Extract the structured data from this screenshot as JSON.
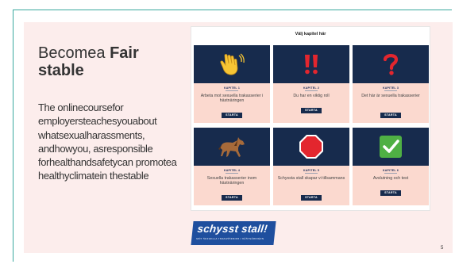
{
  "slide": {
    "title_plain": "Becomea",
    "title_bold_1": "Fair",
    "title_bold_2": "stable",
    "description": "The onlinecoursefor employersteachesyouabout whatsexualharassments, andhowyou, asresponsible forhealthandsafetycan promotea healthyclimatein thestable",
    "page_number": "5"
  },
  "course_page": {
    "heading": "Välj kapitel här",
    "button_label": "STARTA",
    "chapters": [
      {
        "label": "KAPITEL 1",
        "title": "Arbeta mot sexuella trakasserier i hästnäringen",
        "icon": "waving-hand-icon"
      },
      {
        "label": "KAPITEL 2",
        "title": "Du har en viktig roll",
        "icon": "double-exclamation-icon"
      },
      {
        "label": "KAPITEL 3",
        "title": "Det här är sexuella trakasserier",
        "icon": "question-mark-icon"
      },
      {
        "label": "KAPITEL 4",
        "title": "Sexuella trakasserier inom hästnäringen",
        "icon": "horse-icon"
      },
      {
        "label": "KAPITEL 5",
        "title": "Schyssta stall skapar vi tillsammans",
        "icon": "stop-sign-icon"
      },
      {
        "label": "KAPITEL 6",
        "title": "Avslutning och test",
        "icon": "check-mark-icon"
      }
    ]
  },
  "logo": {
    "main_text": "schysst stall!",
    "sub_text": "MOT SEXUELLA TRAKASSERIER I HÄSTNÄRINGEN"
  },
  "colors": {
    "accent_frame": "#3aa89e",
    "panel_bg": "#fcedec",
    "card_art_bg": "#172b4d",
    "card_body_bg": "#fbd9cf",
    "logo_bg": "#1f4f9e"
  }
}
